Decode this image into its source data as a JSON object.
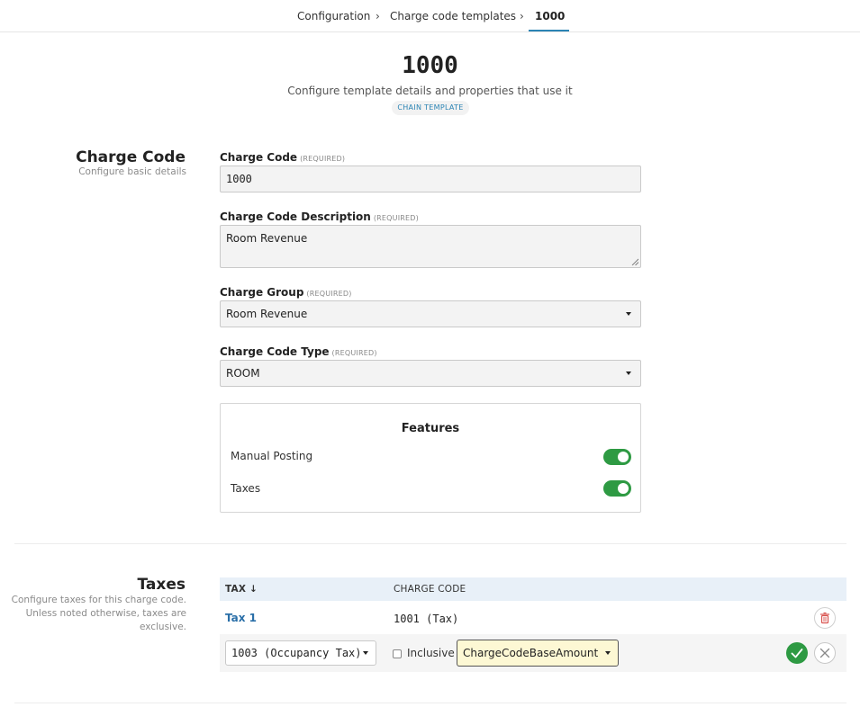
{
  "breadcrumb": {
    "items": [
      "Configuration",
      "Charge code templates",
      "1000"
    ],
    "separator": "›"
  },
  "header": {
    "title": "1000",
    "subtitle": "Configure template details and properties that use it",
    "badge": "CHAIN TEMPLATE"
  },
  "charge_code_section": {
    "title": "Charge Code",
    "description": "Configure basic details",
    "required_tag": "(REQUIRED)",
    "fields": {
      "charge_code": {
        "label": "Charge Code",
        "value": "1000"
      },
      "description": {
        "label": "Charge Code Description",
        "value": "Room Revenue"
      },
      "charge_group": {
        "label": "Charge Group",
        "value": "Room Revenue"
      },
      "charge_code_type": {
        "label": "Charge Code Type",
        "value": "ROOM"
      }
    },
    "features": {
      "title": "Features",
      "items": [
        {
          "label": "Manual Posting",
          "enabled": true
        },
        {
          "label": "Taxes",
          "enabled": true
        }
      ]
    }
  },
  "taxes_section": {
    "title": "Taxes",
    "description_lines": [
      "Configure taxes for this charge code.",
      "Unless noted otherwise, taxes are",
      "exclusive."
    ],
    "columns": {
      "tax": "TAX",
      "sort_arrow": "↓",
      "charge_code": "CHARGE CODE"
    },
    "rows": [
      {
        "tax": "Tax 1",
        "charge_code": "1001 (Tax)"
      }
    ],
    "edit_row": {
      "tax_select": "1003 (Occupancy Tax)",
      "inclusive_label": "Inclusive",
      "inclusive_checked": false,
      "base_select": "ChargeCodeBaseAmount"
    }
  },
  "colors": {
    "accent": "#2b84b4",
    "toggle_on": "#2e9a43",
    "delete": "#d9534f",
    "confirm": "#2e9a43",
    "highlight": "#fdf8d4"
  },
  "icons": [
    "chevron-right-icon",
    "caret-down-icon",
    "sort-down-icon",
    "trash-icon",
    "check-icon",
    "close-icon"
  ]
}
